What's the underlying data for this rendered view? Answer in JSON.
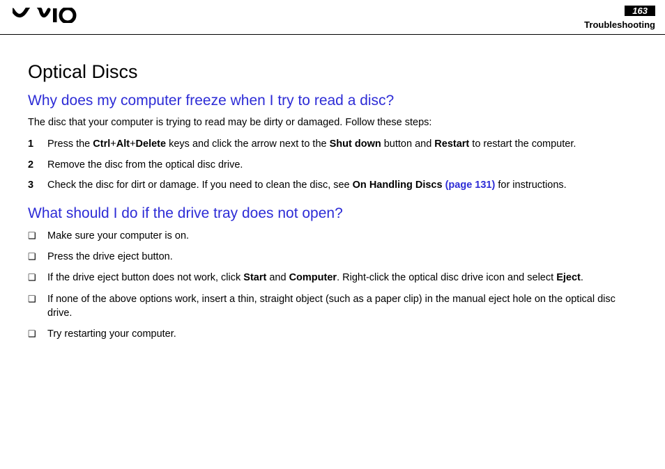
{
  "header": {
    "page_number": "163",
    "section": "Troubleshooting"
  },
  "title": "Optical Discs",
  "q1": {
    "heading": "Why does my computer freeze when I try to read a disc?",
    "intro": "The disc that your computer is trying to read may be dirty or damaged. Follow these steps:",
    "steps": [
      {
        "n": "1",
        "pre": "Press the ",
        "b1": "Ctrl",
        "p1": "+",
        "b2": "Alt",
        "p2": "+",
        "b3": "Delete",
        "mid1": " keys and click the arrow next to the ",
        "b4": "Shut down",
        "mid2": " button and ",
        "b5": "Restart",
        "post": " to restart the computer."
      },
      {
        "n": "2",
        "text": "Remove the disc from the optical disc drive."
      },
      {
        "n": "3",
        "pre": "Check the disc for dirt or damage. If you need to clean the disc, see ",
        "b1": "On Handling Discs ",
        "link": "(page 131)",
        "post": " for instructions."
      }
    ]
  },
  "q2": {
    "heading": "What should I do if the drive tray does not open?",
    "items": [
      {
        "text": "Make sure your computer is on."
      },
      {
        "text": "Press the drive eject button."
      },
      {
        "pre": "If the drive eject button does not work, click ",
        "b1": "Start",
        "mid1": " and ",
        "b2": "Computer",
        "mid2": ". Right-click the optical disc drive icon and select ",
        "b3": "Eject",
        "post": "."
      },
      {
        "text": "If none of the above options work, insert a thin, straight object (such as a paper clip) in the manual eject hole on the optical disc drive."
      },
      {
        "text": "Try restarting your computer."
      }
    ]
  }
}
